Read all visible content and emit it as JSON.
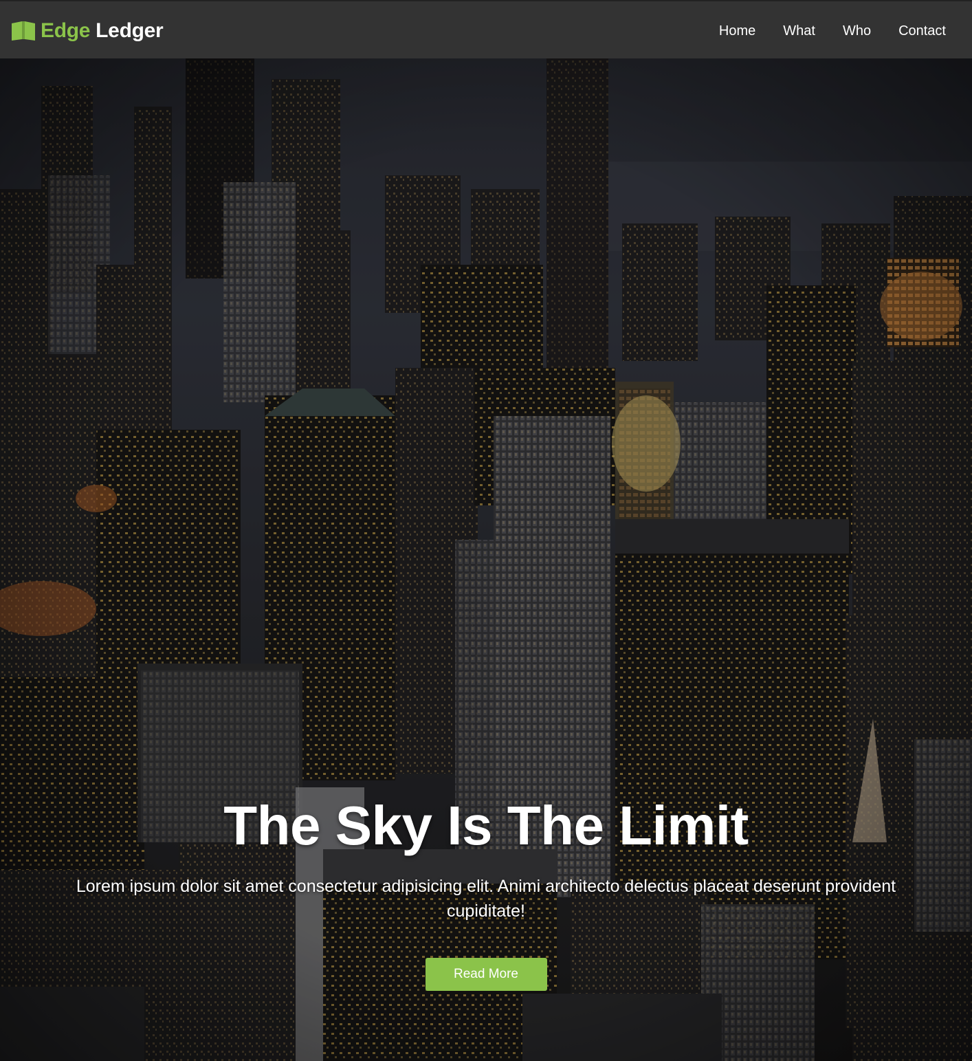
{
  "brand": {
    "accent": "Edge",
    "name": "Ledger",
    "icon": "book-open-icon",
    "accent_color": "#8bc34a"
  },
  "nav": {
    "items": [
      {
        "label": "Home"
      },
      {
        "label": "What"
      },
      {
        "label": "Who"
      },
      {
        "label": "Contact"
      }
    ],
    "background": "#333333"
  },
  "hero": {
    "title": "The Sky Is The Limit",
    "text": "Lorem ipsum dolor sit amet consectetur adipisicing elit. Animi architecto delectus placeat deserunt provident cupiditate!",
    "button_label": "Read More",
    "button_color": "#8bc34a",
    "background_image": "night-city-skyline-aerial"
  }
}
